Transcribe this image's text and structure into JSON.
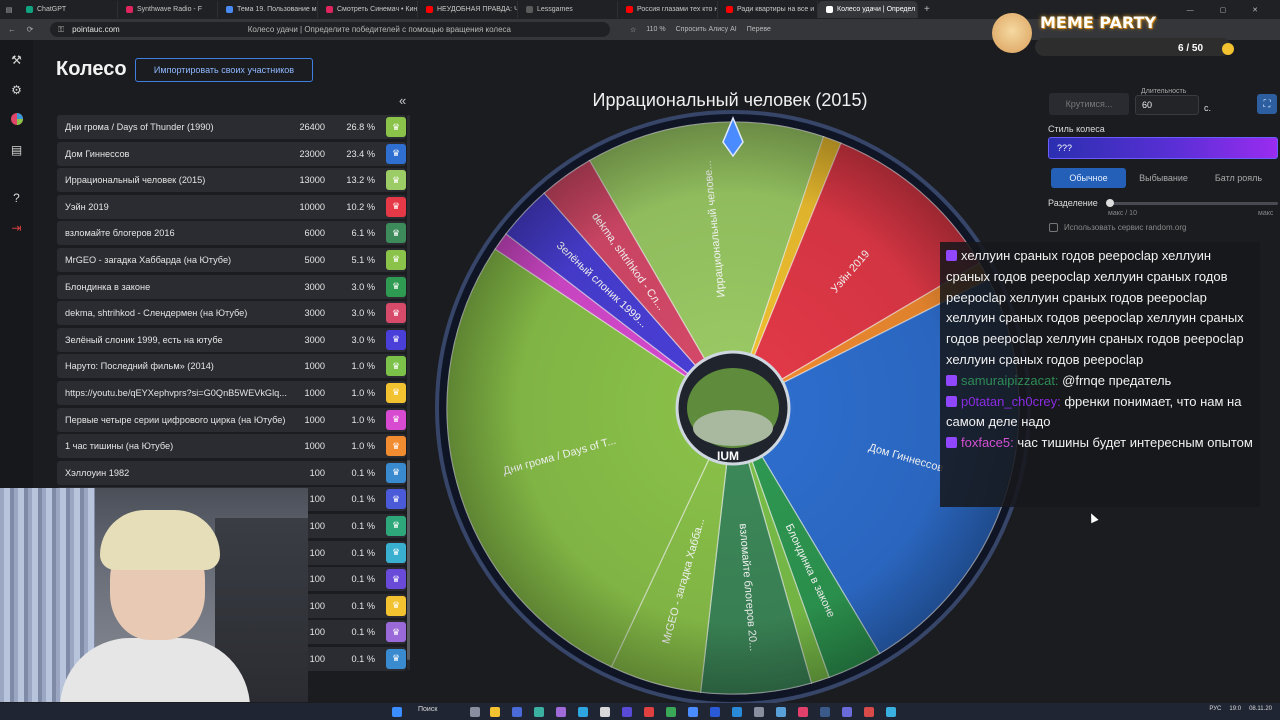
{
  "browser": {
    "tabs": [
      {
        "label": "ChatGPT",
        "color": "#10a37f"
      },
      {
        "label": "Synthwave Radio - F",
        "color": "#e0245e"
      },
      {
        "label": "Тема 19. Пользование ма",
        "color": "#4a8af4"
      },
      {
        "label": "Смотреть Синемач • Кин",
        "color": "#e0245e"
      },
      {
        "label": "НЕУДОБНАЯ ПРАВДА: Ч",
        "color": "#ff0000"
      },
      {
        "label": "Lessgames",
        "color": "#5a5a5a"
      },
      {
        "label": "Россия глазами тех кто н",
        "color": "#ff0000"
      },
      {
        "label": "Ради квартиры на все и",
        "color": "#ff0000"
      },
      {
        "label": "Колесо удачи | Определ",
        "color": "#ffffff",
        "active": true
      }
    ],
    "url": "pointauc.com",
    "page_title": "Колесо удачи | Определите победителей с помощью вращения колеса",
    "zoom": "110 %",
    "alice": "Спросить Алису AI",
    "extra": "Переве"
  },
  "header": {
    "title": "Колесо",
    "import_label": "Импортировать своих участников",
    "collapse_glyph": "«"
  },
  "participants": [
    {
      "name": "Дни грома / Days of Thunder (1990)",
      "amount": "26400",
      "percent": "26.8 %",
      "color": "#8bc34a"
    },
    {
      "name": "Дом Гиннессов",
      "amount": "23000",
      "percent": "23.4 %",
      "color": "#2e6fd0"
    },
    {
      "name": "Иррациональный человек (2015)",
      "amount": "13000",
      "percent": "13.2 %",
      "color": "#9ccc65"
    },
    {
      "name": "Уэйн 2019",
      "amount": "10000",
      "percent": "10.2 %",
      "color": "#e53948"
    },
    {
      "name": "взломайте блогеров 2016",
      "amount": "6000",
      "percent": "6.1 %",
      "color": "#3d8a5a"
    },
    {
      "name": "MrGEO - загадка Хаббарда (на Ютубе)",
      "amount": "5000",
      "percent": "5.1 %",
      "color": "#8bc34a"
    },
    {
      "name": "Блондинка в законе",
      "amount": "3000",
      "percent": "3.0 %",
      "color": "#2e9a52"
    },
    {
      "name": "dekma, shtrihkod - Слендермен (на Ютубе)",
      "amount": "3000",
      "percent": "3.0 %",
      "color": "#d84a6a"
    },
    {
      "name": "Зелёный слоник 1999, есть на ютубе",
      "amount": "3000",
      "percent": "3.0 %",
      "color": "#4a3fd8"
    },
    {
      "name": "Наруто: Последний фильм» (2014)",
      "amount": "1000",
      "percent": "1.0 %",
      "color": "#7cc24a"
    },
    {
      "name": "https://youtu.be/qEYXephvprs?si=G0QnB5WEVkGlq...",
      "amount": "1000",
      "percent": "1.0 %",
      "color": "#f2c230"
    },
    {
      "name": "Первые четыре серии цифрового цирка (на Ютубе)",
      "amount": "1000",
      "percent": "1.0 %",
      "color": "#d84ad0"
    },
    {
      "name": "1 час тишины (на Ютубе)",
      "amount": "1000",
      "percent": "1.0 %",
      "color": "#f28c30"
    },
    {
      "name": "Хэллоуин 1982",
      "amount": "100",
      "percent": "0.1 %",
      "color": "#3a8ad0"
    },
    {
      "name": "",
      "amount": "100",
      "percent": "0.1 %",
      "color": "#4a5ad8"
    },
    {
      "name": "",
      "amount": "100",
      "percent": "0.1 %",
      "color": "#2ea87a"
    },
    {
      "name": "",
      "amount": "100",
      "percent": "0.1 %",
      "color": "#3ab0d0"
    },
    {
      "name": "",
      "amount": "100",
      "percent": "0.1 %",
      "color": "#6a4ad8"
    },
    {
      "name": "",
      "amount": "100",
      "percent": "0.1 %",
      "color": "#f2c230"
    },
    {
      "name": "",
      "amount": "100",
      "percent": "0.1 %",
      "color": "#9a6ad8"
    },
    {
      "name": "",
      "amount": "100",
      "percent": "0.1 %",
      "color": "#3a8ad0"
    }
  ],
  "wheel": {
    "title": "Иррациональный человек (2015)",
    "center_text": "IUM",
    "sectors": [
      {
        "label": "Иррациональный челове...",
        "value": 13000,
        "color": "#9ccc65"
      },
      {
        "label": "",
        "value": 1000,
        "color": "#f2c230"
      },
      {
        "label": "Уэйн 2019",
        "value": 10000,
        "color": "#e53948"
      },
      {
        "label": "",
        "value": 1000,
        "color": "#f28c30"
      },
      {
        "label": "Дом Гиннессов",
        "value": 23000,
        "color": "#2e6fd0"
      },
      {
        "label": "Блондинка в законе",
        "value": 3000,
        "color": "#2e9a52"
      },
      {
        "label": "",
        "value": 1000,
        "color": "#7cc24a"
      },
      {
        "label": "взломайте блогеров 20...",
        "value": 6000,
        "color": "#3d8a5a"
      },
      {
        "label": "MrGEO - загадка Хабба...",
        "value": 5000,
        "color": "#8bc34a"
      },
      {
        "label": "Дни грома / Days of T...",
        "value": 26400,
        "color": "#8bc34a"
      },
      {
        "label": "",
        "value": 1000,
        "color": "#d84ad0"
      },
      {
        "label": "Зелёный слоник 1999...",
        "value": 3000,
        "color": "#4a3fd8"
      },
      {
        "label": "dekma, shtrihkod - Сл...",
        "value": 3000,
        "color": "#d84a6a"
      }
    ]
  },
  "controls": {
    "spin_label": "Крутимся...",
    "duration_label": "Длительность",
    "duration_value": "60",
    "seconds": "с.",
    "style_label": "Стиль колеса",
    "style_value": "???",
    "modes": [
      "Обычное",
      "Выбывание",
      "Батл рояль"
    ],
    "split_label": "Разделение",
    "split_hint": "макс / 10",
    "split_hint_right": "макс",
    "random_label": "Использовать сервис random.org"
  },
  "chat": {
    "messages": [
      {
        "user": "",
        "text": "хеллуин сраных годов peepoclap хеллуин сраных годов peepoclap хеллуин сраных годов peepoclap хеллуин сраных годов peepoclap хеллуин сраных годов peepoclap хеллуин сраных годов peepoclap хеллуин сраных годов peepoclap хеллуин сраных годов peepoclap",
        "color": "#ffffff"
      },
      {
        "user": "samuraipizzacat:",
        "text": "@frnqe предатель",
        "color": "#2e8b57"
      },
      {
        "user": "p0tatan_ch0crey:",
        "text": "френки понимает, что нам на самом деле надо",
        "color": "#8a2be2"
      },
      {
        "user": "foxface5:",
        "text": "час тишины будет интересным опытом",
        "color": "#d34fd3"
      }
    ]
  },
  "meme_widget": {
    "title": "MEME PARTY",
    "count": "6 / 50"
  },
  "taskbar": {
    "search": "Поиск",
    "lang": "РУС",
    "time": "19:0",
    "date": "08.11.20"
  },
  "icons": {
    "sidebar": [
      "hammer-icon",
      "gear-icon",
      "wheel-icon",
      "clipboard-icon",
      "help-icon",
      "logout-icon"
    ]
  }
}
